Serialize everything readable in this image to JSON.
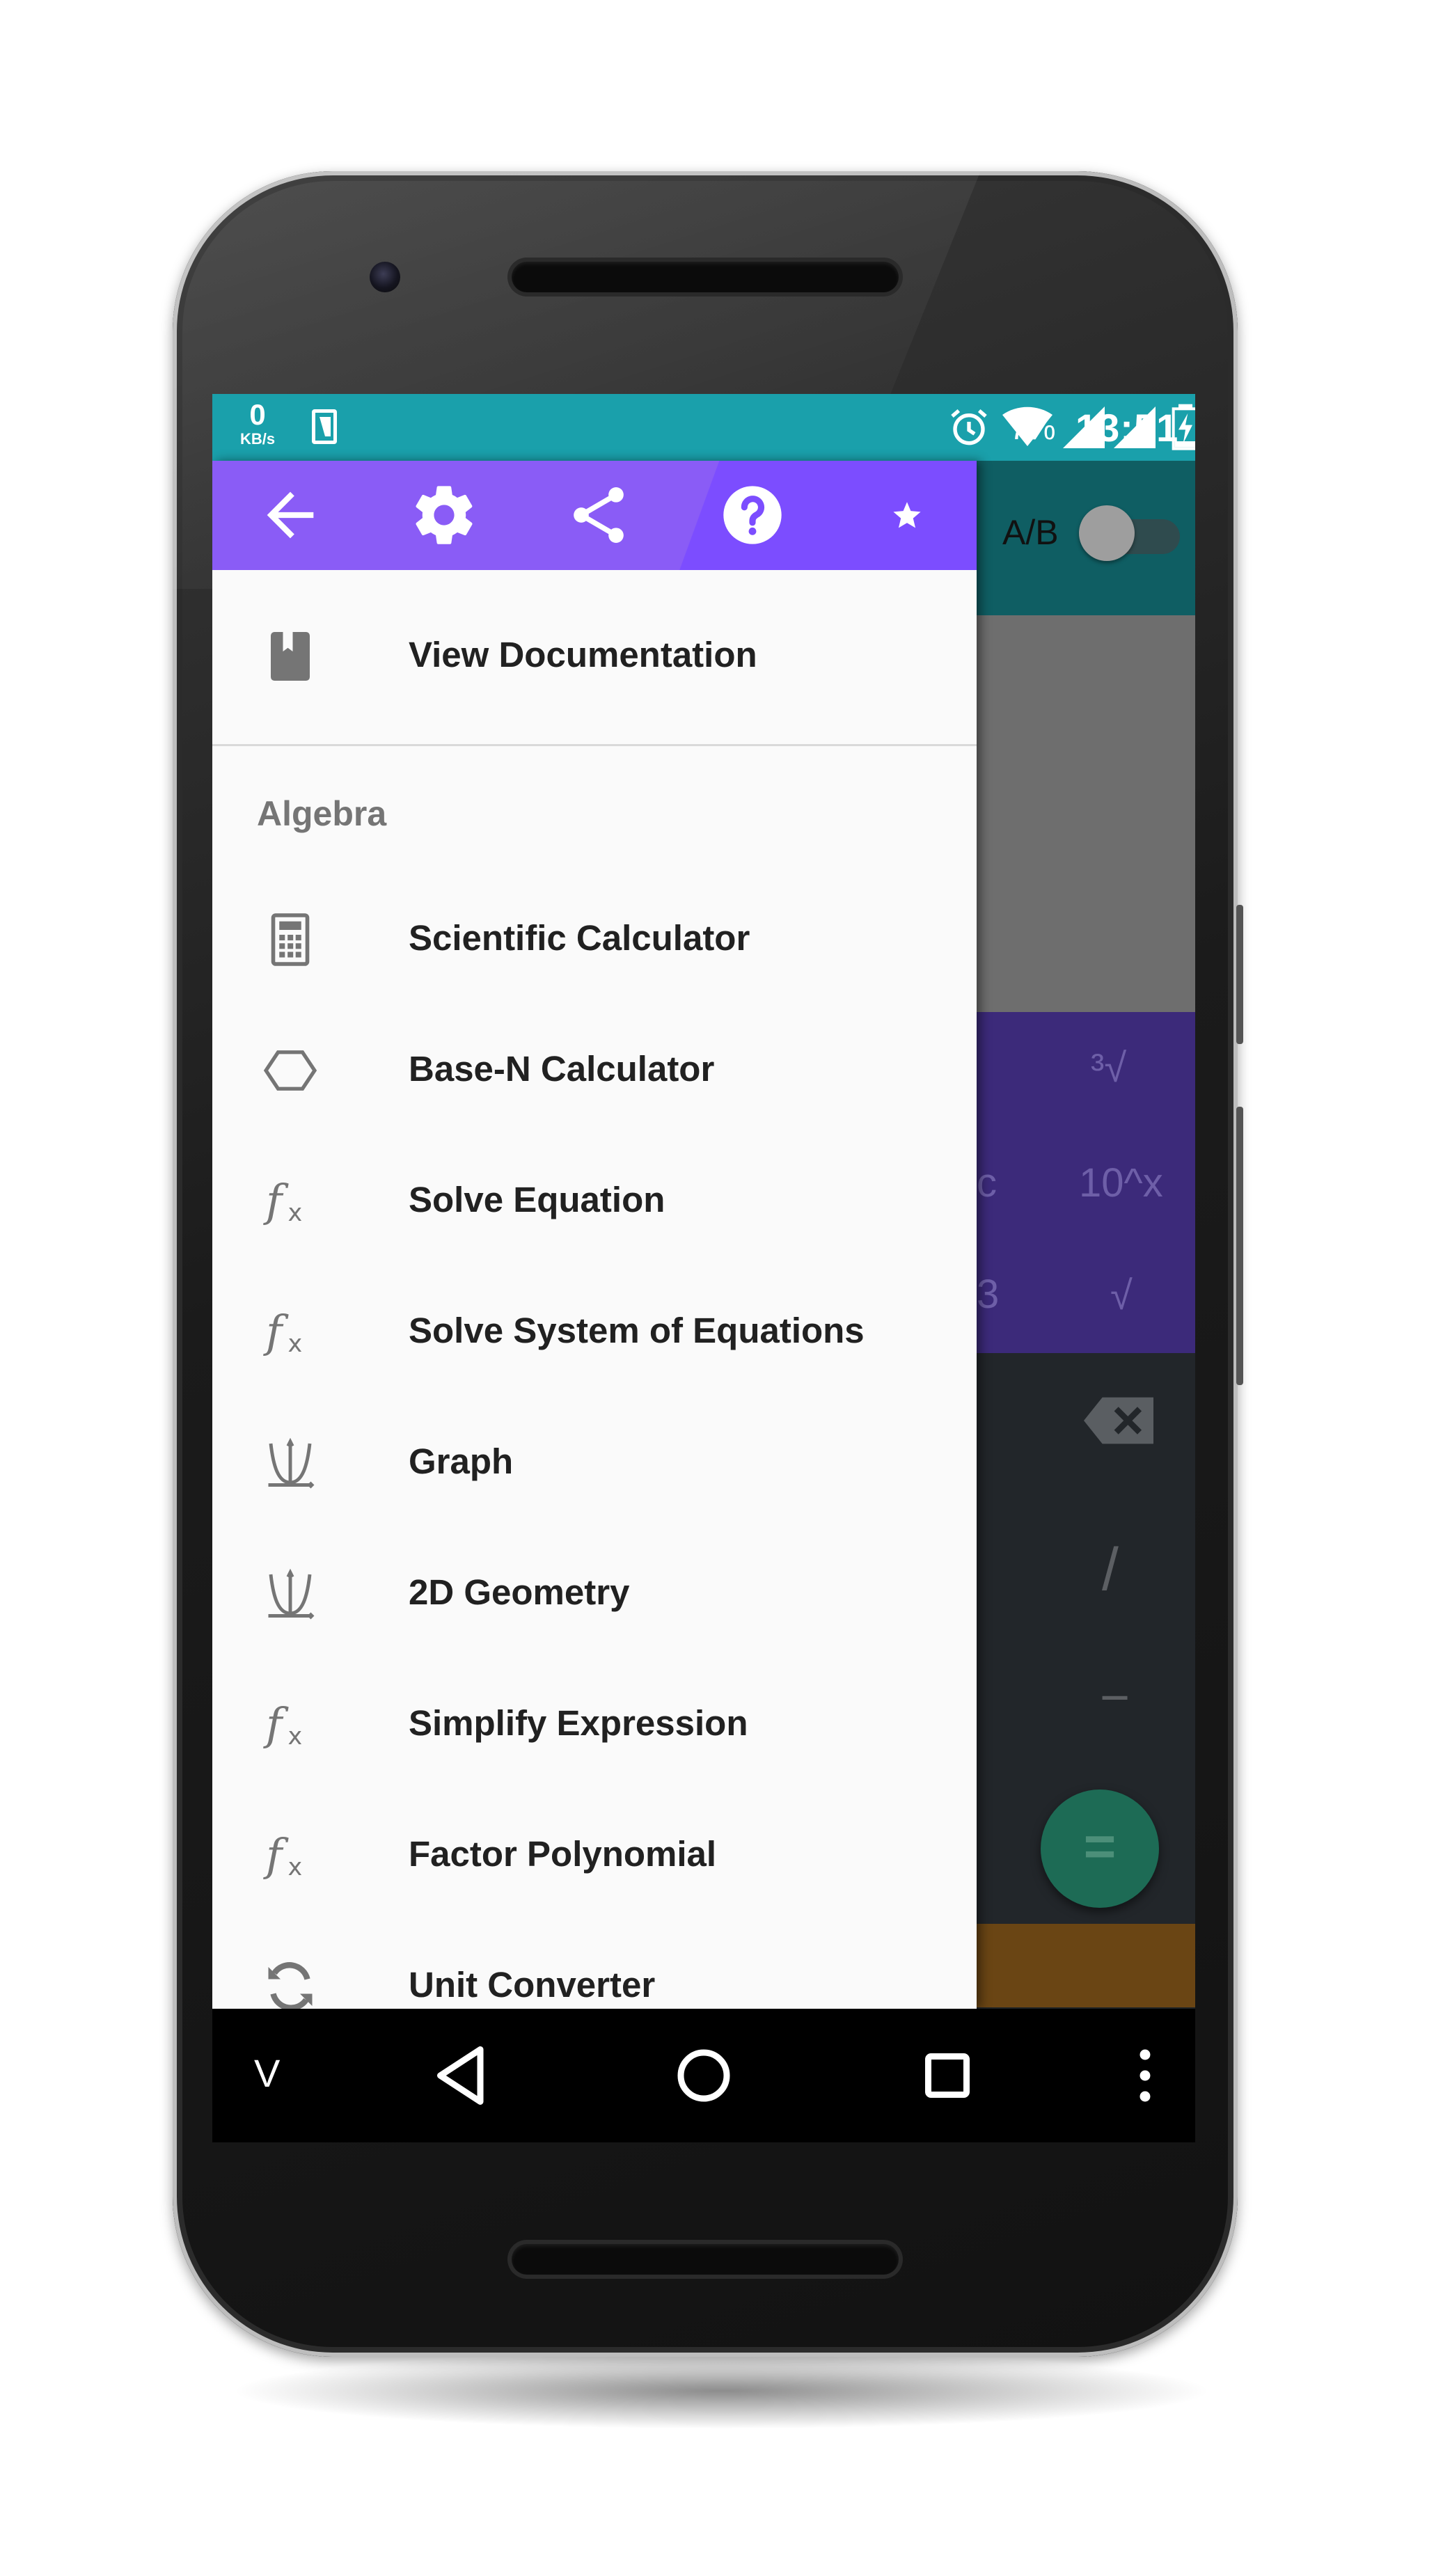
{
  "status_bar": {
    "net_speed_value": "0",
    "net_speed_unit": "KB/s",
    "battery_percent": "7%",
    "time": "13:51"
  },
  "background_app": {
    "ab_toggle_label": "A/B",
    "keys": [
      "³√",
      "c",
      "10^x",
      "3",
      "√",
      "/",
      "−",
      "="
    ]
  },
  "drawer": {
    "header_icons": [
      "back-arrow-icon",
      "gear-icon",
      "share-icon",
      "help-icon",
      "star-icon"
    ],
    "documentation_label": "View Documentation",
    "section_title": "Algebra",
    "items": [
      {
        "label": "Scientific Calculator",
        "icon": "calculator-icon"
      },
      {
        "label": "Base-N Calculator",
        "icon": "hexagon-icon"
      },
      {
        "label": "Solve Equation",
        "icon": "function-icon"
      },
      {
        "label": "Solve System of Equations",
        "icon": "function-icon"
      },
      {
        "label": "Graph",
        "icon": "graph-icon"
      },
      {
        "label": "2D Geometry",
        "icon": "graph-icon"
      },
      {
        "label": "Simplify Expression",
        "icon": "function-icon"
      },
      {
        "label": "Factor Polynomial",
        "icon": "function-icon"
      },
      {
        "label": "Unit Converter",
        "icon": "convert-icon"
      }
    ]
  },
  "nav_bar": {
    "collapse_label": "V"
  },
  "colors": {
    "status_bar": "#1aa0ab",
    "drawer_header": "#8a5cf6",
    "drawer_header_accent": "#7c4dff",
    "icon_gray": "#757575"
  }
}
